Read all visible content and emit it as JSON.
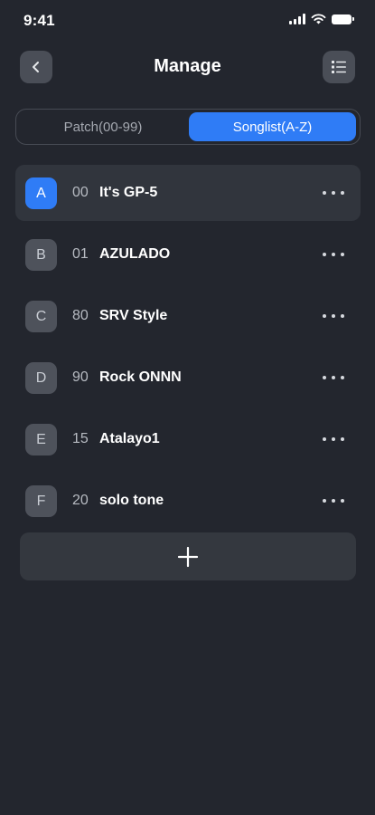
{
  "status": {
    "time": "9:41"
  },
  "header": {
    "title": "Manage"
  },
  "tabs": [
    {
      "label": "Patch(00-99)",
      "selected": false
    },
    {
      "label": "Songlist(A-Z)",
      "selected": true
    }
  ],
  "songs": [
    {
      "letter": "A",
      "number": "00",
      "name": "It's GP-5",
      "active": true
    },
    {
      "letter": "B",
      "number": "01",
      "name": "AZULADO",
      "active": false
    },
    {
      "letter": "C",
      "number": "80",
      "name": "SRV Style",
      "active": false
    },
    {
      "letter": "D",
      "number": "90",
      "name": "Rock ONNN",
      "active": false
    },
    {
      "letter": "E",
      "number": "15",
      "name": "Atalayo1",
      "active": false
    },
    {
      "letter": "F",
      "number": "20",
      "name": "solo tone",
      "active": false
    }
  ],
  "icons": {
    "back": "chevron-left-icon",
    "menu": "list-icon",
    "more": "more-horizontal-icon",
    "add": "plus-icon"
  },
  "colors": {
    "background": "#23262e",
    "accent": "#2f7cf6",
    "row_active": "#31353d",
    "badge": "#4e525b"
  }
}
